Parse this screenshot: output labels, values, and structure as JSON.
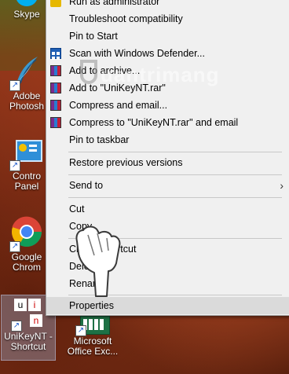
{
  "desktop": {
    "icons": [
      {
        "label_line1": "Skype",
        "label_line2": ""
      },
      {
        "label_line1": "Adobe",
        "label_line2": "Photosh"
      },
      {
        "label_line1": "Contro",
        "label_line2": "Panel"
      },
      {
        "label_line1": "Google",
        "label_line2": "Chrom"
      },
      {
        "label_line1": "UniKeyNT -",
        "label_line2": "Shortcut"
      },
      {
        "label_line1": "Microsoft",
        "label_line2": "Office Exc..."
      }
    ]
  },
  "menu": {
    "items": [
      {
        "label": "Run as administrator",
        "icon": "shield-icon"
      },
      {
        "label": "Troubleshoot compatibility",
        "icon": ""
      },
      {
        "label": "Pin to Start",
        "icon": ""
      },
      {
        "label": "Scan with Windows Defender...",
        "icon": "windows-defender-icon"
      },
      {
        "label": "Add to archive...",
        "icon": "winrar-icon"
      },
      {
        "label": "Add to \"UniKeyNT.rar\"",
        "icon": "winrar-icon"
      },
      {
        "label": "Compress and email...",
        "icon": "winrar-icon"
      },
      {
        "label": "Compress to \"UniKeyNT.rar\" and email",
        "icon": "winrar-icon"
      },
      {
        "label": "Pin to taskbar",
        "icon": ""
      },
      {
        "label": "Restore previous versions",
        "icon": ""
      },
      {
        "label": "Send to",
        "icon": "",
        "submenu": true
      },
      {
        "label": "Cut",
        "icon": ""
      },
      {
        "label": "Copy",
        "icon": ""
      },
      {
        "label": "Create shortcut",
        "icon": ""
      },
      {
        "label": "Delete",
        "icon": ""
      },
      {
        "label": "Rename",
        "icon": ""
      },
      {
        "label": "Properties",
        "icon": "",
        "highlighted": true
      }
    ],
    "submenu_arrow": "›"
  },
  "watermark": {
    "text": "uantrimang"
  },
  "colors": {
    "menu_bg": "#f0f0f0",
    "highlight": "#dadada",
    "separator": "#c8c8c8"
  }
}
